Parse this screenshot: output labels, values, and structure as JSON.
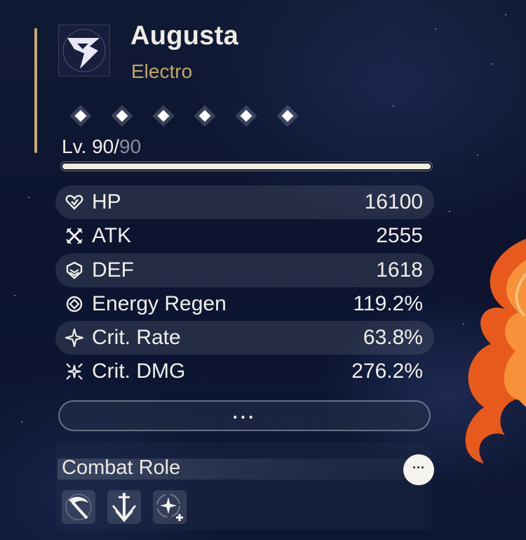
{
  "character": {
    "name": "Augusta",
    "element": "Electro",
    "element_color": "#c0a665"
  },
  "sequence": {
    "nodes": [
      "diamond-icon",
      "diamond-icon",
      "diamond-icon",
      "diamond-icon",
      "diamond-icon",
      "diamond-icon"
    ]
  },
  "level": {
    "prefix": "Lv. ",
    "current": "90",
    "separator": "/",
    "max": "90",
    "progress_fraction": 1.0
  },
  "stats": [
    {
      "label": "HP",
      "value": "16100",
      "icon": "hp-icon"
    },
    {
      "label": "ATK",
      "value": "2555",
      "icon": "atk-icon"
    },
    {
      "label": "DEF",
      "value": "1618",
      "icon": "def-icon"
    },
    {
      "label": "Energy Regen",
      "value": "119.2%",
      "icon": "energy-regen-icon"
    },
    {
      "label": "Crit. Rate",
      "value": "63.8%",
      "icon": "crit-rate-icon"
    },
    {
      "label": "Crit. DMG",
      "value": "276.2%",
      "icon": "crit-dmg-icon"
    }
  ],
  "more_button": {
    "label": "..."
  },
  "combat_role": {
    "title": "Combat Role",
    "more_label": "···",
    "icons": [
      "scythe-icon",
      "sword-down-icon",
      "sparkle-plus-icon"
    ]
  },
  "colors": {
    "accent_gold": "#c5a97a",
    "background": "#0b1226",
    "flame": "#e85a1c"
  }
}
